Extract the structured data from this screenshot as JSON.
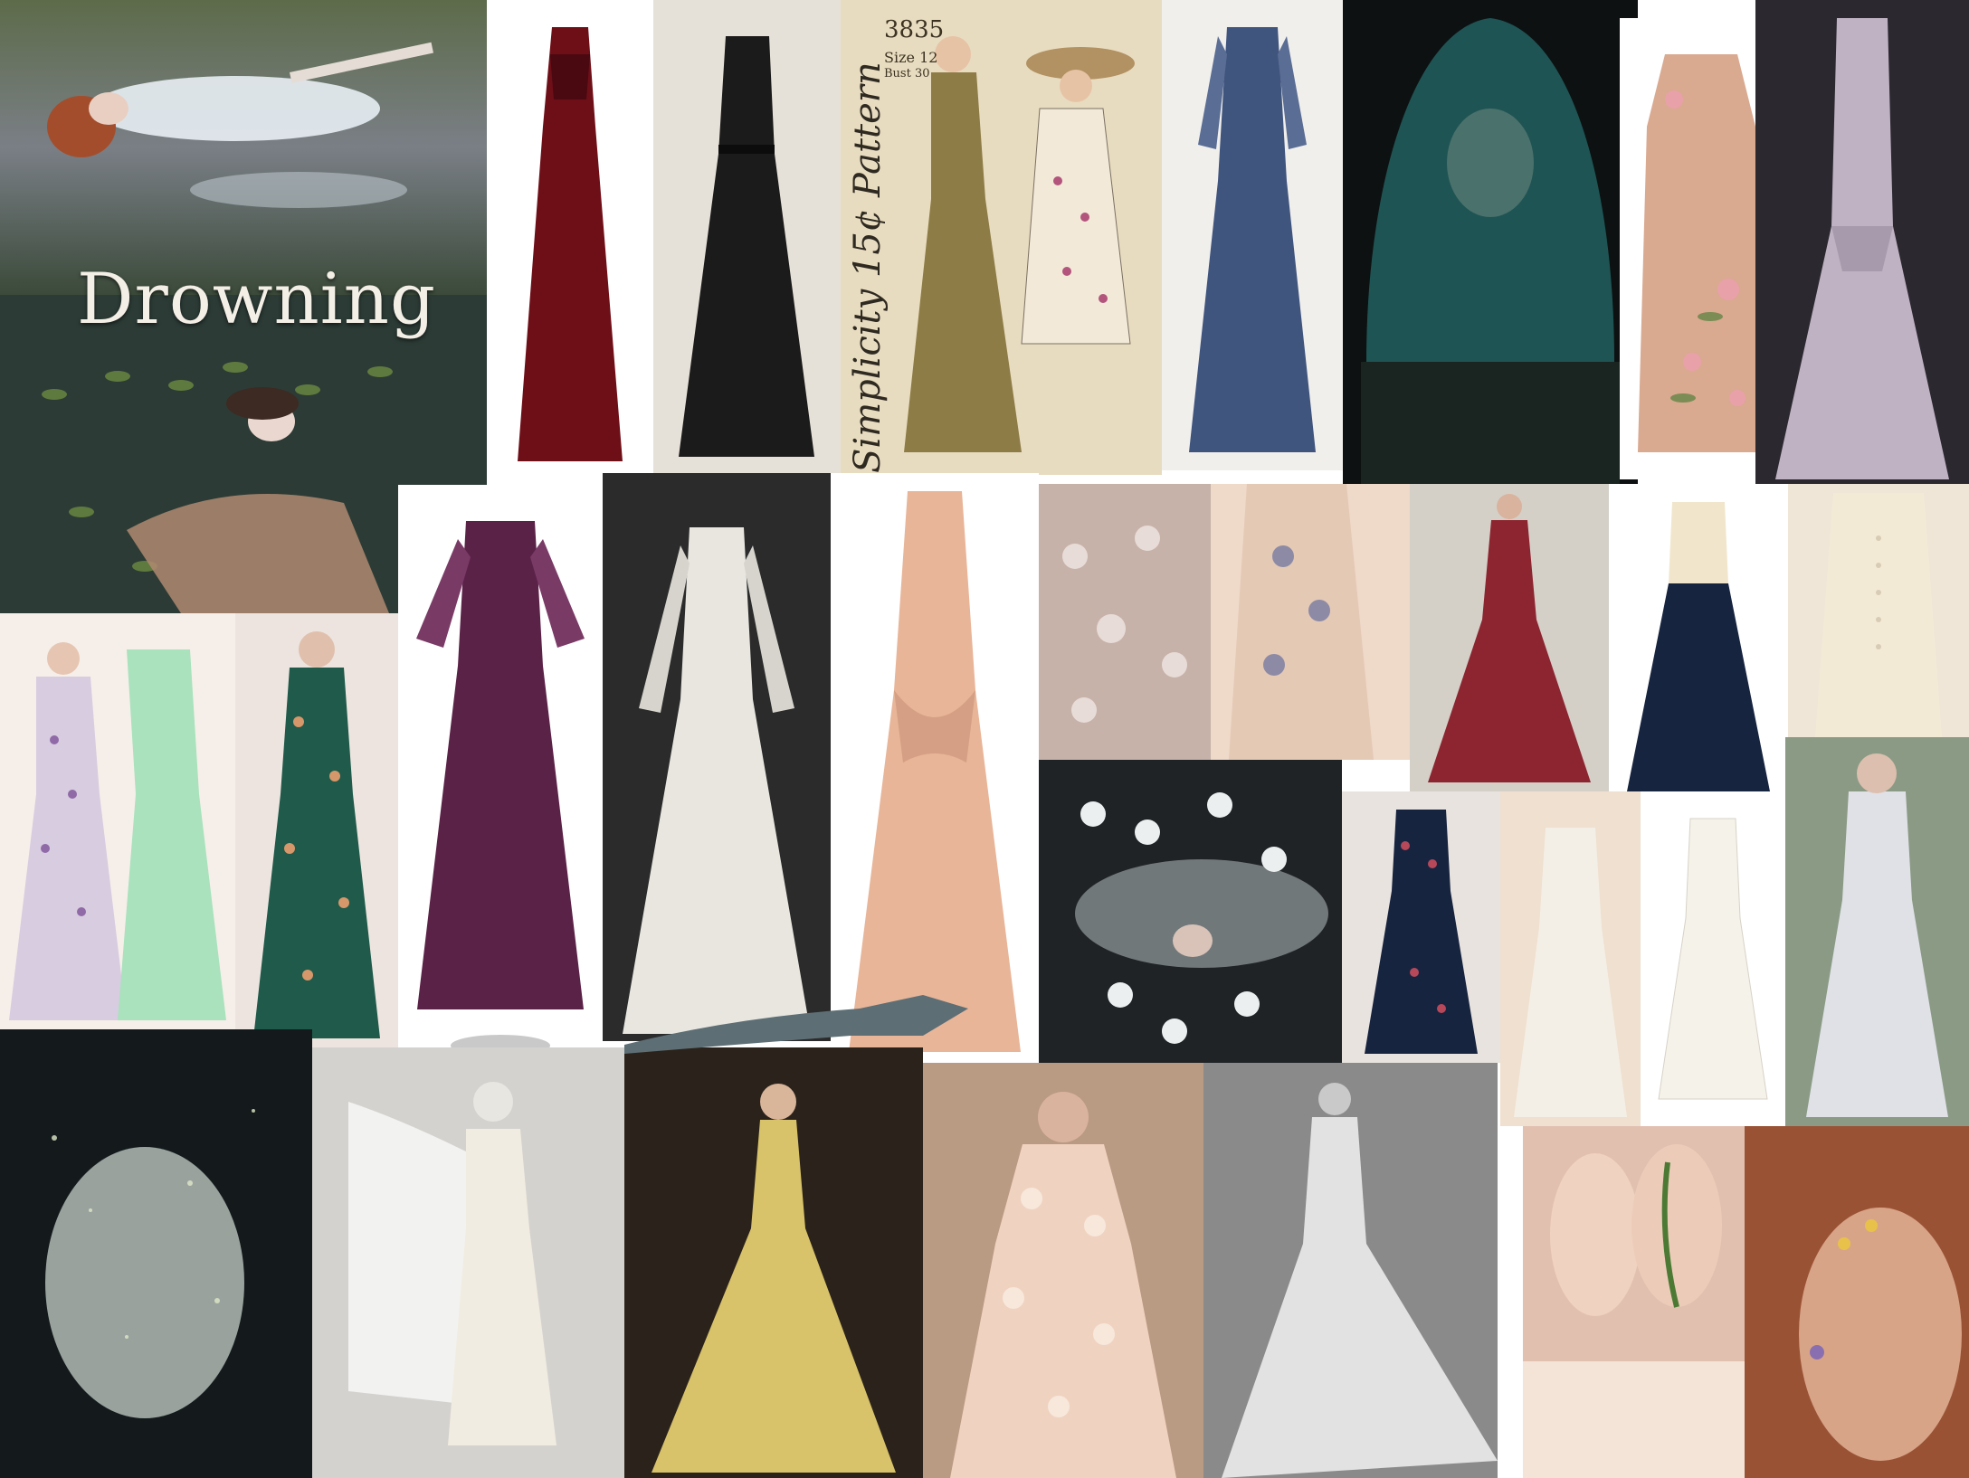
{
  "board": {
    "title": "Drowning"
  },
  "pattern": {
    "number": "3835",
    "size_line": "Size 12",
    "bust_line": "Bust 30",
    "brand": "Simplicity",
    "price": "15¢",
    "word": "Pattern"
  },
  "colors": {
    "red_velvet": "#6e0f18",
    "black_gown": "#1b1b1b",
    "olive_pattern": "#8d7c46",
    "blue_gown": "#40557e",
    "teal_veil": "#1f5454",
    "peach_floral": "#d9a990",
    "lilac_gown": "#bfb2c2",
    "plum_gown": "#5b2248",
    "ivory_gown": "#e8e6df",
    "peach_satin": "#e8b598",
    "mint_gown": "#a9e2bd",
    "green_print": "#1f5a4a",
    "burgundy_gown": "#8d2530",
    "navy_gown": "#17243f",
    "yellow_gown": "#d8c36a"
  }
}
